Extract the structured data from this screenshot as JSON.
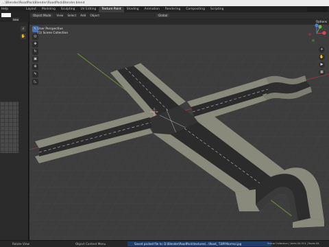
{
  "titlebar": {
    "text": "...\\Blender\\RoadPackBlender\\RoadPackBlender.blend"
  },
  "menu": {
    "items": [
      "Help"
    ],
    "workspaces": [
      "Layout",
      "Modeling",
      "Sculpting",
      "UV Editing",
      "Texture Paint",
      "Shading",
      "Animation",
      "Rendering",
      "Compositing",
      "Scripting"
    ],
    "active_workspace": "Texture Paint"
  },
  "left_panel": {
    "new_label": "New"
  },
  "viewport": {
    "header": {
      "mode": "Object Mode",
      "menus": [
        "View",
        "Select",
        "Add",
        "Object"
      ],
      "orientation": "Global",
      "options": "Options"
    },
    "overlay": {
      "line1": "User Perspective",
      "line2": "(1) Scene Collection"
    }
  },
  "status": {
    "left": "Rotate View",
    "middle": "Object Context Menu",
    "message": "Saved packed file to: D:\\Blender\\RoadPack\\textures\\...\\Road_ T.BPP.Normal.jpg",
    "right": "Scene Collection | Verts:34,913 | Faces:34,"
  },
  "colors": {
    "accent": "#4772b3",
    "axis_x": "#a8363f",
    "axis_y": "#78a33a",
    "grid": "#464646"
  }
}
